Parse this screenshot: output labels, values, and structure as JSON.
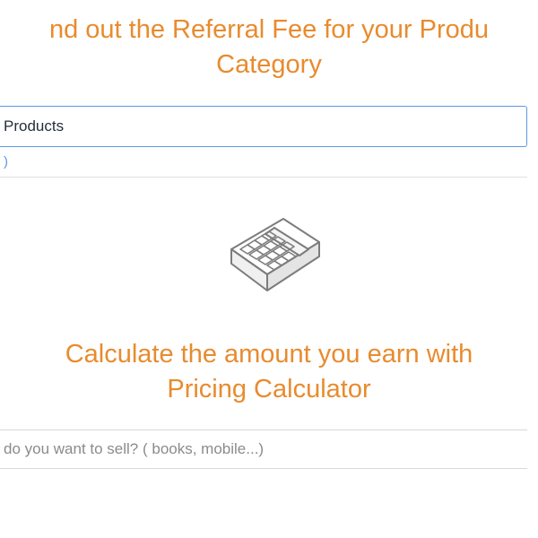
{
  "referral": {
    "heading": "nd out the Referral Fee for your Produ Category",
    "dropdown_value": "Products",
    "paren": ")"
  },
  "calculator": {
    "heading": "Calculate the amount you earn with Pricing Calculator",
    "search_placeholder": "do you want to sell? ( books, mobile...)"
  },
  "icons": {
    "calculator": "calculator-icon"
  }
}
